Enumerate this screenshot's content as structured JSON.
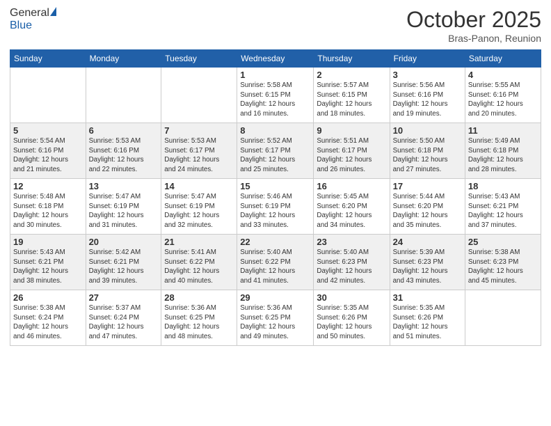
{
  "header": {
    "logo_general": "General",
    "logo_blue": "Blue",
    "month_title": "October 2025",
    "location": "Bras-Panon, Reunion"
  },
  "weekdays": [
    "Sunday",
    "Monday",
    "Tuesday",
    "Wednesday",
    "Thursday",
    "Friday",
    "Saturday"
  ],
  "weeks": [
    [
      {
        "day": "",
        "info": ""
      },
      {
        "day": "",
        "info": ""
      },
      {
        "day": "",
        "info": ""
      },
      {
        "day": "1",
        "info": "Sunrise: 5:58 AM\nSunset: 6:15 PM\nDaylight: 12 hours\nand 16 minutes."
      },
      {
        "day": "2",
        "info": "Sunrise: 5:57 AM\nSunset: 6:15 PM\nDaylight: 12 hours\nand 18 minutes."
      },
      {
        "day": "3",
        "info": "Sunrise: 5:56 AM\nSunset: 6:16 PM\nDaylight: 12 hours\nand 19 minutes."
      },
      {
        "day": "4",
        "info": "Sunrise: 5:55 AM\nSunset: 6:16 PM\nDaylight: 12 hours\nand 20 minutes."
      }
    ],
    [
      {
        "day": "5",
        "info": "Sunrise: 5:54 AM\nSunset: 6:16 PM\nDaylight: 12 hours\nand 21 minutes."
      },
      {
        "day": "6",
        "info": "Sunrise: 5:53 AM\nSunset: 6:16 PM\nDaylight: 12 hours\nand 22 minutes."
      },
      {
        "day": "7",
        "info": "Sunrise: 5:53 AM\nSunset: 6:17 PM\nDaylight: 12 hours\nand 24 minutes."
      },
      {
        "day": "8",
        "info": "Sunrise: 5:52 AM\nSunset: 6:17 PM\nDaylight: 12 hours\nand 25 minutes."
      },
      {
        "day": "9",
        "info": "Sunrise: 5:51 AM\nSunset: 6:17 PM\nDaylight: 12 hours\nand 26 minutes."
      },
      {
        "day": "10",
        "info": "Sunrise: 5:50 AM\nSunset: 6:18 PM\nDaylight: 12 hours\nand 27 minutes."
      },
      {
        "day": "11",
        "info": "Sunrise: 5:49 AM\nSunset: 6:18 PM\nDaylight: 12 hours\nand 28 minutes."
      }
    ],
    [
      {
        "day": "12",
        "info": "Sunrise: 5:48 AM\nSunset: 6:18 PM\nDaylight: 12 hours\nand 30 minutes."
      },
      {
        "day": "13",
        "info": "Sunrise: 5:47 AM\nSunset: 6:19 PM\nDaylight: 12 hours\nand 31 minutes."
      },
      {
        "day": "14",
        "info": "Sunrise: 5:47 AM\nSunset: 6:19 PM\nDaylight: 12 hours\nand 32 minutes."
      },
      {
        "day": "15",
        "info": "Sunrise: 5:46 AM\nSunset: 6:19 PM\nDaylight: 12 hours\nand 33 minutes."
      },
      {
        "day": "16",
        "info": "Sunrise: 5:45 AM\nSunset: 6:20 PM\nDaylight: 12 hours\nand 34 minutes."
      },
      {
        "day": "17",
        "info": "Sunrise: 5:44 AM\nSunset: 6:20 PM\nDaylight: 12 hours\nand 35 minutes."
      },
      {
        "day": "18",
        "info": "Sunrise: 5:43 AM\nSunset: 6:21 PM\nDaylight: 12 hours\nand 37 minutes."
      }
    ],
    [
      {
        "day": "19",
        "info": "Sunrise: 5:43 AM\nSunset: 6:21 PM\nDaylight: 12 hours\nand 38 minutes."
      },
      {
        "day": "20",
        "info": "Sunrise: 5:42 AM\nSunset: 6:21 PM\nDaylight: 12 hours\nand 39 minutes."
      },
      {
        "day": "21",
        "info": "Sunrise: 5:41 AM\nSunset: 6:22 PM\nDaylight: 12 hours\nand 40 minutes."
      },
      {
        "day": "22",
        "info": "Sunrise: 5:40 AM\nSunset: 6:22 PM\nDaylight: 12 hours\nand 41 minutes."
      },
      {
        "day": "23",
        "info": "Sunrise: 5:40 AM\nSunset: 6:23 PM\nDaylight: 12 hours\nand 42 minutes."
      },
      {
        "day": "24",
        "info": "Sunrise: 5:39 AM\nSunset: 6:23 PM\nDaylight: 12 hours\nand 43 minutes."
      },
      {
        "day": "25",
        "info": "Sunrise: 5:38 AM\nSunset: 6:23 PM\nDaylight: 12 hours\nand 45 minutes."
      }
    ],
    [
      {
        "day": "26",
        "info": "Sunrise: 5:38 AM\nSunset: 6:24 PM\nDaylight: 12 hours\nand 46 minutes."
      },
      {
        "day": "27",
        "info": "Sunrise: 5:37 AM\nSunset: 6:24 PM\nDaylight: 12 hours\nand 47 minutes."
      },
      {
        "day": "28",
        "info": "Sunrise: 5:36 AM\nSunset: 6:25 PM\nDaylight: 12 hours\nand 48 minutes."
      },
      {
        "day": "29",
        "info": "Sunrise: 5:36 AM\nSunset: 6:25 PM\nDaylight: 12 hours\nand 49 minutes."
      },
      {
        "day": "30",
        "info": "Sunrise: 5:35 AM\nSunset: 6:26 PM\nDaylight: 12 hours\nand 50 minutes."
      },
      {
        "day": "31",
        "info": "Sunrise: 5:35 AM\nSunset: 6:26 PM\nDaylight: 12 hours\nand 51 minutes."
      },
      {
        "day": "",
        "info": ""
      }
    ]
  ]
}
